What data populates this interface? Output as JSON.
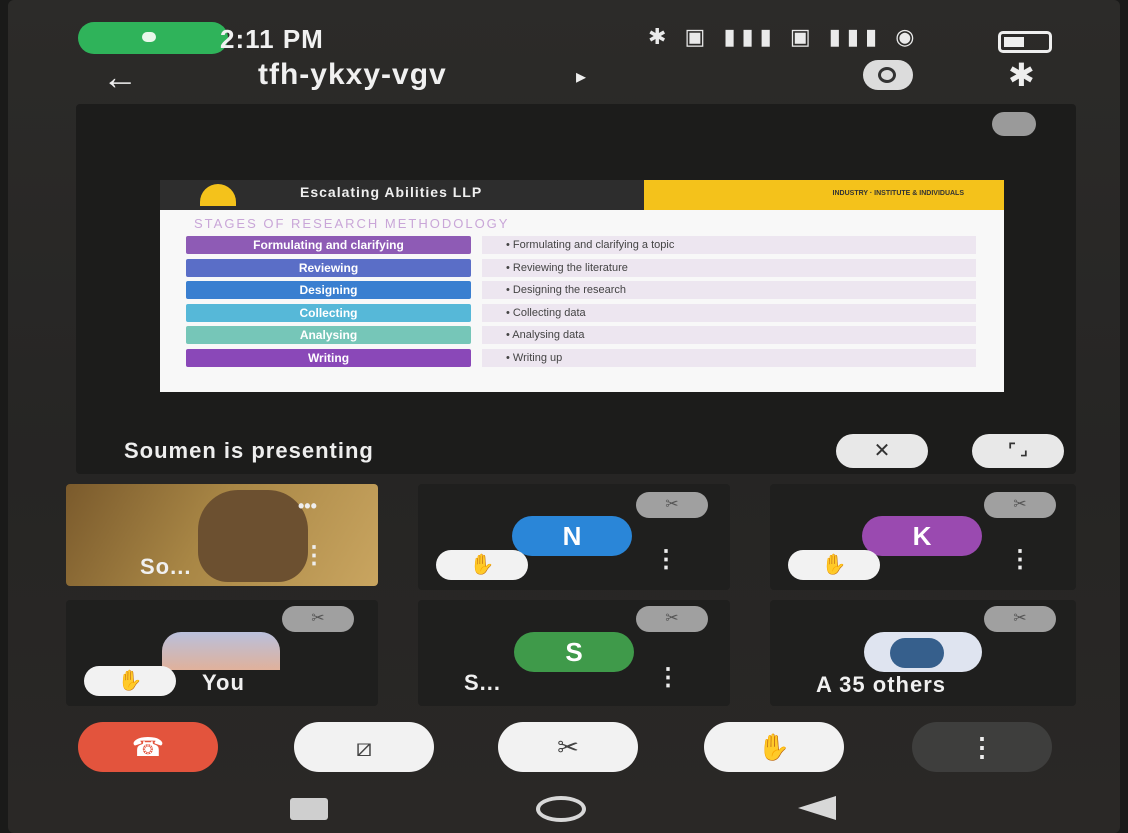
{
  "status_bar": {
    "time": "2:11 PM",
    "left_icons": "@ ● ♪",
    "right_icons": "✱ ▣ ▮▮▮ ▣ ▮▮▮ ◉"
  },
  "app_bar": {
    "back_icon": "←",
    "meeting_code": "tfh-ykxy-vgv",
    "chevron": "▸",
    "bluetooth_icon": "✱"
  },
  "presentation": {
    "presenting_text": "Soumen is presenting",
    "mic_icon": "✂",
    "pin_icon": "✕",
    "fullscreen_icon": "⌜ ⌟",
    "slide": {
      "brand": "Escalating Abilities LLP",
      "tagline": "INDUSTRY · INSTITUTE & INDIVIDUALS",
      "title": "STAGES OF RESEARCH METHODOLOGY",
      "steps": [
        {
          "label": "Formulating and clarifying",
          "desc": "• Formulating and clarifying a topic",
          "color": "#8e5bb5"
        },
        {
          "label": "Reviewing",
          "desc": "• Reviewing the literature",
          "color": "#5a6ec7"
        },
        {
          "label": "Designing",
          "desc": "• Designing the research",
          "color": "#3a7fd0"
        },
        {
          "label": "Collecting",
          "desc": "• Collecting data",
          "color": "#56b8d8"
        },
        {
          "label": "Analysing",
          "desc": "• Analysing data",
          "color": "#76c6b8"
        },
        {
          "label": "Writing",
          "desc": "• Writing up",
          "color": "#8a48b8"
        }
      ]
    }
  },
  "participants": [
    {
      "label": "So...",
      "type": "video"
    },
    {
      "initial": "N",
      "color": "#2a86d8",
      "type": "avatar"
    },
    {
      "initial": "K",
      "color": "#9a4ab0",
      "type": "avatar"
    },
    {
      "label": "You",
      "type": "photo"
    },
    {
      "label": "S...",
      "initial": "S",
      "color": "#3f9a4a",
      "type": "avatar"
    },
    {
      "label": "A 35 others",
      "type": "photo"
    }
  ],
  "icons": {
    "hand": "✋",
    "kebab": "⋮",
    "mic_muted": "✂",
    "end_call": "☎",
    "camera_off": "⧄",
    "mic_off": "✂",
    "raise_hand": "✋",
    "more": "⋮"
  }
}
